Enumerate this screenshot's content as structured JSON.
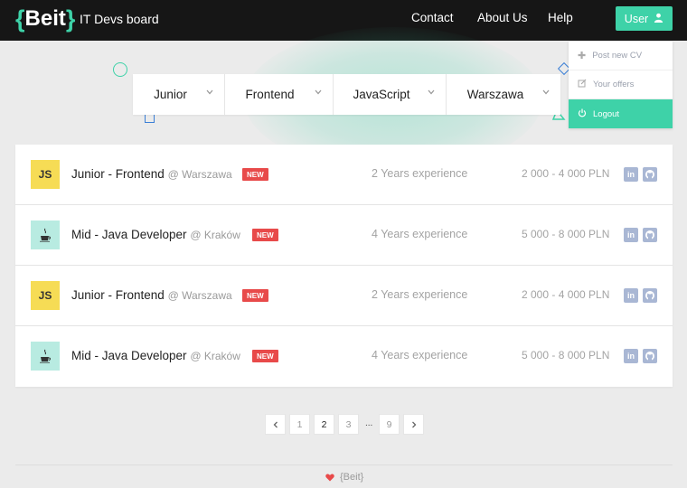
{
  "navbar": {
    "logo_open": "{",
    "logo_word": "Beit",
    "logo_close": "}",
    "subtitle": "IT Devs board",
    "links": [
      "Contact",
      "About Us",
      "Help"
    ],
    "user_label": "User"
  },
  "user_menu": {
    "items": [
      "Post new CV",
      "Your offers",
      "Logout"
    ]
  },
  "filters": [
    "Junior",
    "Frontend",
    "JavaScript",
    "Warszawa"
  ],
  "offers": [
    {
      "badge": "JS",
      "title": "Junior - Frontend",
      "location": "@ Warszawa",
      "tag": "NEW",
      "experience": "2  Years experience",
      "salary": "2 000 - 4 000 PLN"
    },
    {
      "badge": "",
      "title": "Mid - Java Developer",
      "location": "@ Kraków",
      "tag": "NEW",
      "experience": "4  Years experience",
      "salary": "5 000 - 8 000 PLN"
    },
    {
      "badge": "JS",
      "title": "Junior - Frontend",
      "location": "@ Warszawa",
      "tag": "NEW",
      "experience": "2  Years experience",
      "salary": "2 000 - 4 000 PLN"
    },
    {
      "badge": "",
      "title": "Mid - Java Developer",
      "location": "@ Kraków",
      "tag": "NEW",
      "experience": "4  Years experience",
      "salary": "5 000 - 8 000 PLN"
    }
  ],
  "social": {
    "linkedin": "in"
  },
  "pagination": {
    "pages": [
      "1",
      "2",
      "3"
    ],
    "ellipsis": "...",
    "last": "9",
    "current": "2"
  },
  "footer": {
    "text": "{Beit}"
  },
  "colors": {
    "accent": "#3ed2a8",
    "new_tag": "#e84a4a",
    "js_badge": "#f6dc55",
    "java_badge": "#b8ebe1",
    "navbar": "#161616"
  },
  "icons": {
    "user": "user-icon",
    "post": "plus-icon",
    "offers": "edit-icon",
    "logout": "power-icon",
    "java": "coffee-cup-icon",
    "linkedin": "linkedin-icon",
    "github": "github-icon",
    "footer": "heart-icon"
  }
}
